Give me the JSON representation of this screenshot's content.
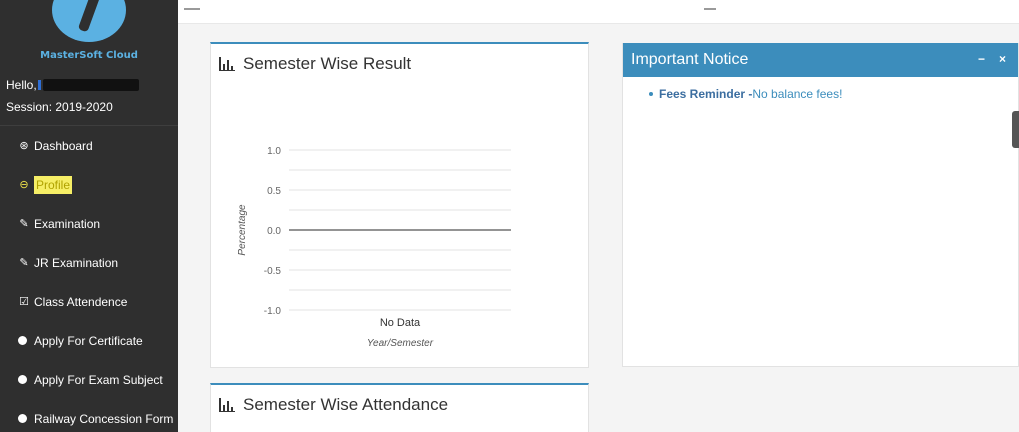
{
  "app": {
    "brand": "MasterSoft Cloud",
    "colors": {
      "sidebar_bg": "#2f2f2f",
      "accent": "#3c8dbc",
      "highlight": "#f6ee66"
    }
  },
  "user": {
    "hello": "Hello,",
    "session": "Session: 2019-2020"
  },
  "sidebar": {
    "items": [
      {
        "label": "Dashboard",
        "icon": "dashboard-icon",
        "glyph": "⊛"
      },
      {
        "label": "Profile",
        "icon": "user-circle-icon",
        "glyph": "⊖"
      },
      {
        "label": "Examination",
        "icon": "pencil-icon",
        "glyph": "✎"
      },
      {
        "label": "JR Examination",
        "icon": "pencil-icon",
        "glyph": "✎"
      },
      {
        "label": "Class Attendence",
        "icon": "checkbox-icon",
        "glyph": "☑"
      },
      {
        "label": "Apply For Certificate",
        "icon": "circle-icon",
        "glyph": ""
      },
      {
        "label": "Apply For Exam Subject",
        "icon": "circle-icon",
        "glyph": ""
      },
      {
        "label": "Railway Concession Form",
        "icon": "circle-icon",
        "glyph": ""
      }
    ]
  },
  "result_panel": {
    "title": "Semester Wise Result"
  },
  "attendance_panel": {
    "title": "Semester Wise Attendance"
  },
  "notice_panel": {
    "title": "Important Notice",
    "minimize": "−",
    "close": "×",
    "items": [
      {
        "label": "Fees Reminder -",
        "message": "No balance fees!"
      }
    ]
  },
  "chart_data": {
    "type": "line",
    "title": "Semester Wise Result",
    "ylabel": "Percentage",
    "xlabel": "Year/Semester",
    "yticks": [
      "1.0",
      "0.5",
      "0.0",
      "-0.5",
      "-1.0"
    ],
    "ylim": [
      -1.0,
      1.0
    ],
    "categories": [
      "No Data"
    ],
    "series": [],
    "grid": true
  }
}
